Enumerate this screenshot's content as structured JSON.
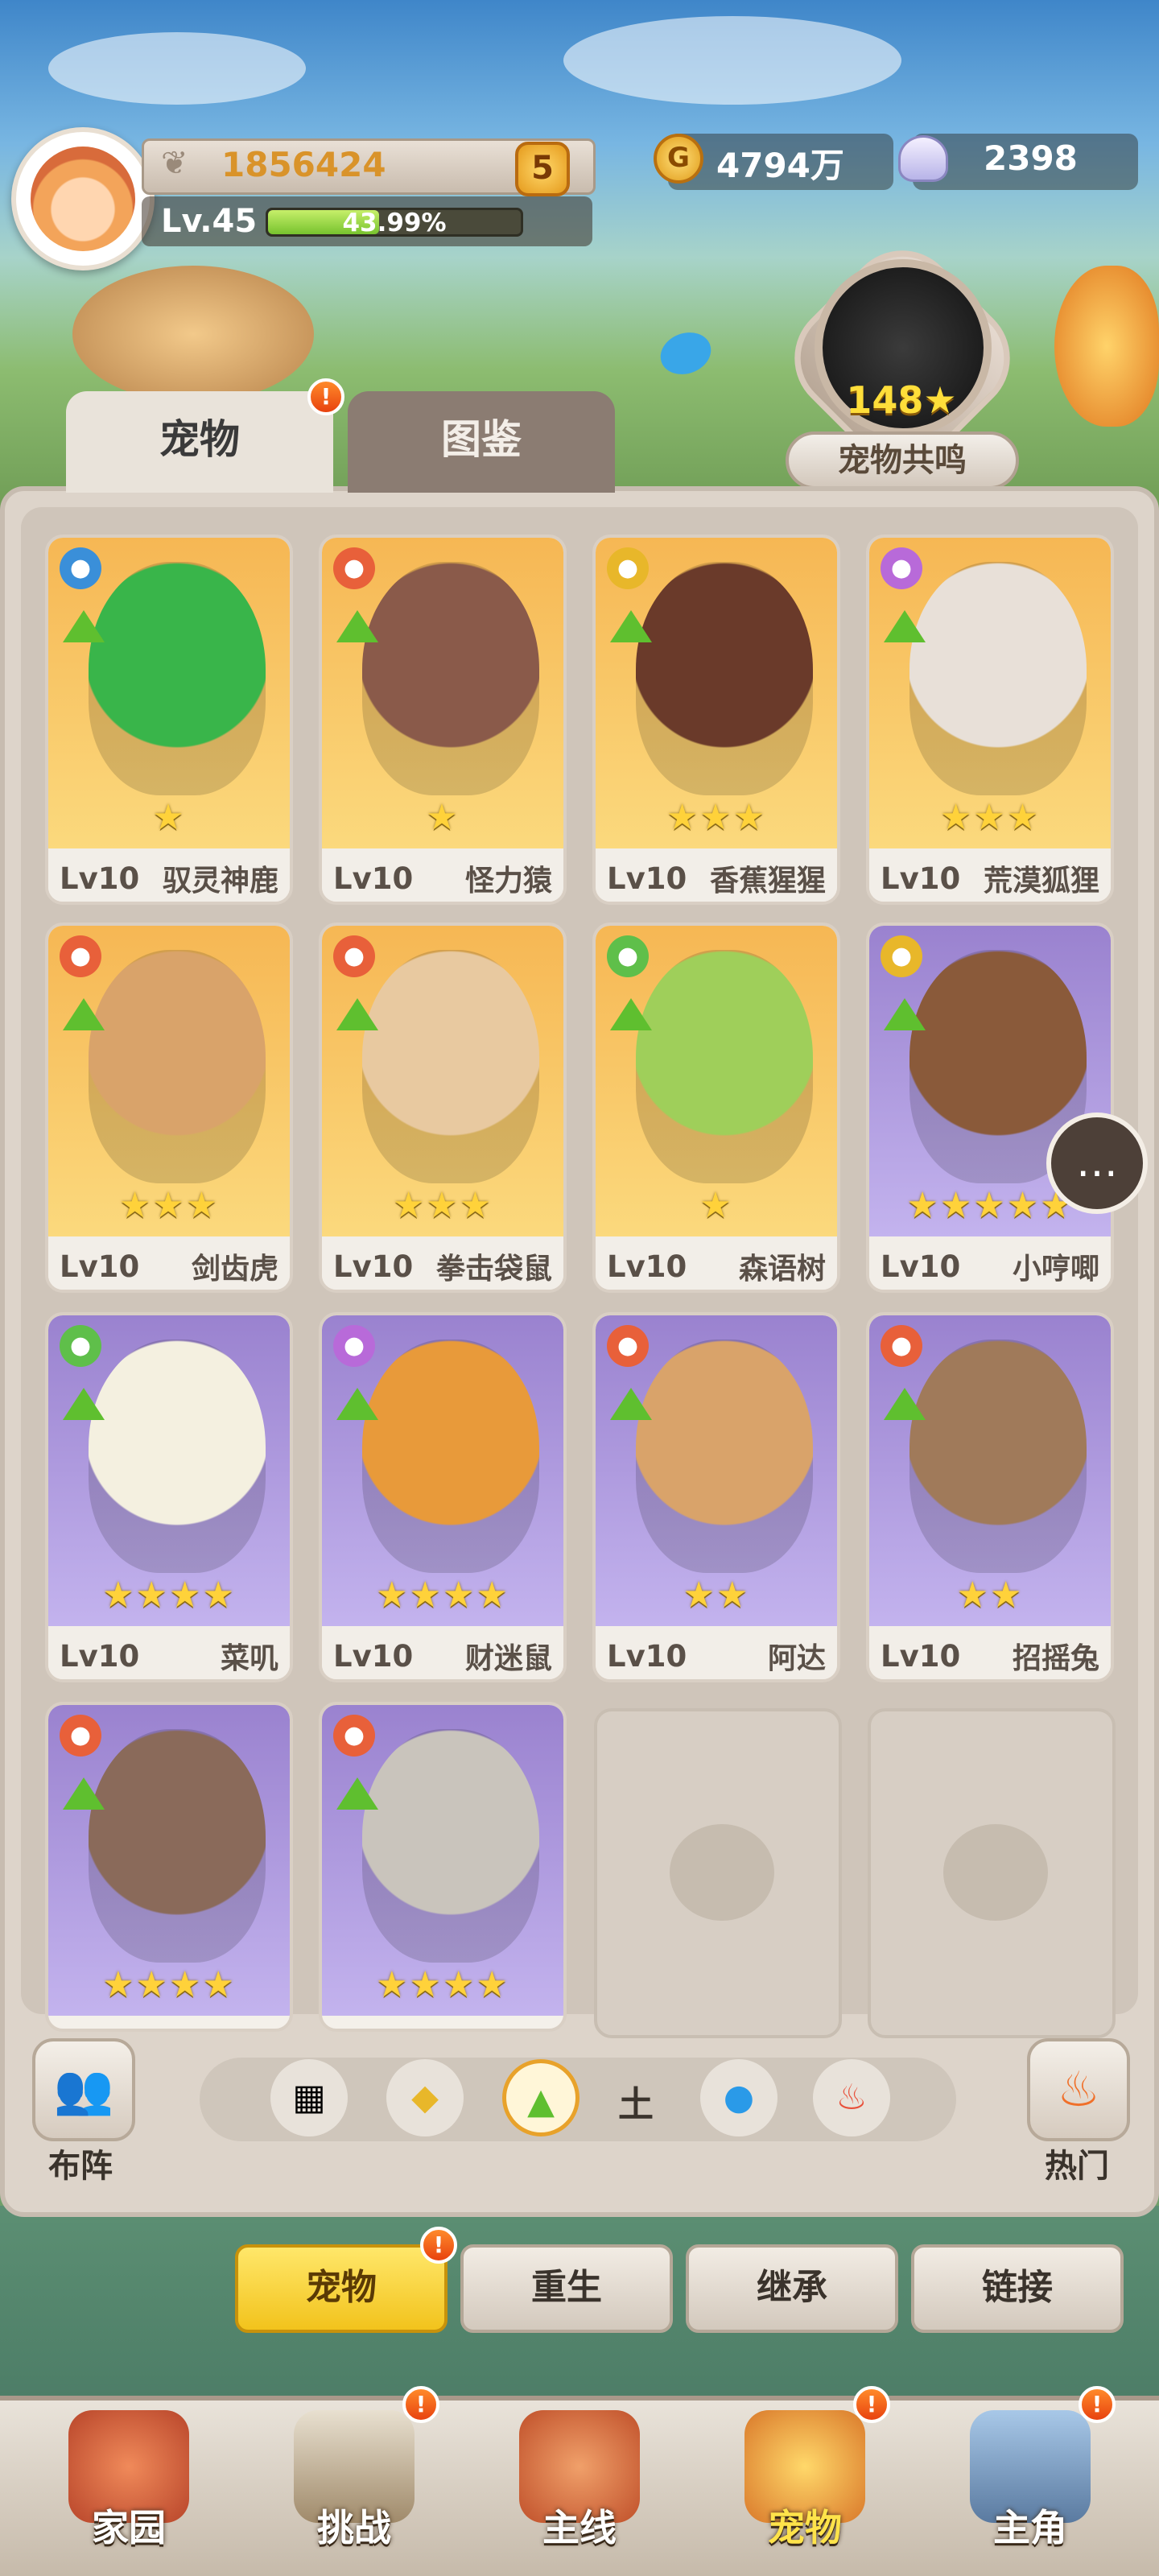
{
  "player": {
    "power": "1856424",
    "rank_badge": "5",
    "level": "Lv.45",
    "exp_percent": "43.99%",
    "exp_fraction": 0.4399
  },
  "currency": {
    "coins": "4794万",
    "coin_symbol": "G",
    "shells": "2398"
  },
  "resonance": {
    "value": "148",
    "star": "★",
    "label": "宠物共鸣"
  },
  "tabs": [
    {
      "label": "宠物",
      "active": true,
      "alert": true
    },
    {
      "label": "图鉴",
      "active": false,
      "alert": false
    }
  ],
  "alert_mark": "!",
  "pets": [
    {
      "level": "Lv10",
      "name": "驭灵神鹿",
      "stars": "★",
      "rarity": "gold",
      "element_color": "#3a8fd9",
      "element": "wind-icon",
      "body_color": "#39b54a"
    },
    {
      "level": "Lv10",
      "name": "怪力猿",
      "stars": "★",
      "rarity": "gold",
      "element_color": "#e8603a",
      "element": "fist-icon",
      "body_color": "#8a5a4a"
    },
    {
      "level": "Lv10",
      "name": "香蕉猩猩",
      "stars": "★★★",
      "rarity": "gold",
      "element_color": "#e8b72a",
      "element": "shield-icon",
      "body_color": "#6a3a2a"
    },
    {
      "level": "Lv10",
      "name": "荒漠狐狸",
      "stars": "★★★",
      "rarity": "gold",
      "element_color": "#b86ad9",
      "element": "spiral-icon",
      "body_color": "#e8e0d8"
    },
    {
      "level": "Lv10",
      "name": "剑齿虎",
      "stars": "★★★",
      "rarity": "gold",
      "element_color": "#e8603a",
      "element": "fist-icon",
      "body_color": "#d9a36a"
    },
    {
      "level": "Lv10",
      "name": "拳击袋鼠",
      "stars": "★★★",
      "rarity": "gold",
      "element_color": "#e8603a",
      "element": "fist-icon",
      "body_color": "#e8c9a0"
    },
    {
      "level": "Lv10",
      "name": "森语树",
      "stars": "★",
      "rarity": "gold",
      "element_color": "#5fbf4a",
      "element": "heart-icon",
      "body_color": "#9fcf5a"
    },
    {
      "level": "Lv10",
      "name": "小哼唧",
      "stars": "★★★★★",
      "rarity": "purple",
      "element_color": "#e8b72a",
      "element": "shield-icon",
      "body_color": "#8a5a3a"
    },
    {
      "level": "Lv10",
      "name": "菜叽",
      "stars": "★★★★",
      "rarity": "purple",
      "element_color": "#5fbf4a",
      "element": "heart-icon",
      "body_color": "#f4f0e0"
    },
    {
      "level": "Lv10",
      "name": "财迷鼠",
      "stars": "★★★★",
      "rarity": "purple",
      "element_color": "#b86ad9",
      "element": "spiral-icon",
      "body_color": "#e89a3a"
    },
    {
      "level": "Lv10",
      "name": "阿达",
      "stars": "★★",
      "rarity": "purple",
      "element_color": "#e8603a",
      "element": "fist-icon",
      "body_color": "#d9a36a"
    },
    {
      "level": "Lv10",
      "name": "招摇兔",
      "stars": "★★",
      "rarity": "purple",
      "element_color": "#e8603a",
      "element": "fist-icon",
      "body_color": "#a07a5a"
    },
    {
      "level": "",
      "name": "",
      "stars": "★★★★",
      "rarity": "purple",
      "element_color": "#e8603a",
      "element": "fist-icon",
      "body_color": "#8a6a5a"
    },
    {
      "level": "",
      "name": "",
      "stars": "★★★★",
      "rarity": "purple",
      "element_color": "#e8603a",
      "element": "fist-icon",
      "body_color": "#c9c4bc"
    }
  ],
  "filters": {
    "lineup_label": "布阵",
    "hot_label": "热门",
    "earth_label": "土",
    "buttons": [
      "all-filter-icon",
      "rock-filter-icon",
      "grass-filter-icon",
      "water-filter-icon",
      "fire-filter-icon"
    ]
  },
  "sub_buttons": [
    {
      "label": "宠物",
      "active": true
    },
    {
      "label": "重生",
      "active": false
    },
    {
      "label": "继承",
      "active": false
    },
    {
      "label": "链接",
      "active": false
    }
  ],
  "nav": [
    {
      "label": "家园",
      "alert": false
    },
    {
      "label": "挑战",
      "alert": true
    },
    {
      "label": "主线",
      "alert": false
    },
    {
      "label": "宠物",
      "alert": true,
      "active": true
    },
    {
      "label": "主角",
      "alert": true
    }
  ]
}
